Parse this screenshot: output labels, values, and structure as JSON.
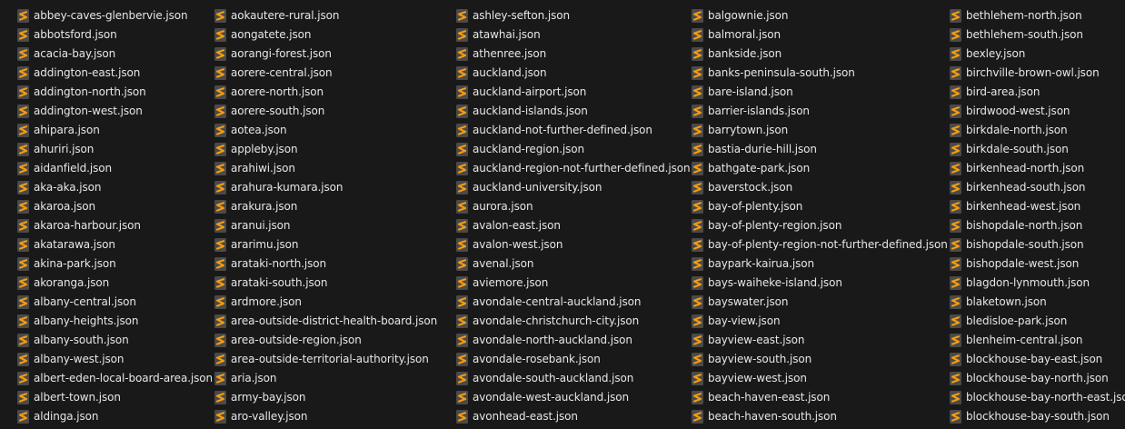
{
  "icon": {
    "name": "sublime-text-file-icon",
    "colors": {
      "background": "#4a4a4a",
      "accent": "#f39c12"
    }
  },
  "columns": [
    {
      "files": [
        "abbey-caves-glenbervie.json",
        "abbotsford.json",
        "acacia-bay.json",
        "addington-east.json",
        "addington-north.json",
        "addington-west.json",
        "ahipara.json",
        "ahuriri.json",
        "aidanfield.json",
        "aka-aka.json",
        "akaroa.json",
        "akaroa-harbour.json",
        "akatarawa.json",
        "akina-park.json",
        "akoranga.json",
        "albany-central.json",
        "albany-heights.json",
        "albany-south.json",
        "albany-west.json",
        "albert-eden-local-board-area.json",
        "albert-town.json",
        "aldinga.json"
      ]
    },
    {
      "files": [
        "aokautere-rural.json",
        "aongatete.json",
        "aorangi-forest.json",
        "aorere-central.json",
        "aorere-north.json",
        "aorere-south.json",
        "aotea.json",
        "appleby.json",
        "arahiwi.json",
        "arahura-kumara.json",
        "arakura.json",
        "aranui.json",
        "ararimu.json",
        "arataki-north.json",
        "arataki-south.json",
        "ardmore.json",
        "area-outside-district-health-board.json",
        "area-outside-region.json",
        "area-outside-territorial-authority.json",
        "aria.json",
        "army-bay.json",
        "aro-valley.json"
      ]
    },
    {
      "files": [
        "ashley-sefton.json",
        "atawhai.json",
        "athenree.json",
        "auckland.json",
        "auckland-airport.json",
        "auckland-islands.json",
        "auckland-not-further-defined.json",
        "auckland-region.json",
        "auckland-region-not-further-defined.json",
        "auckland-university.json",
        "aurora.json",
        "avalon-east.json",
        "avalon-west.json",
        "avenal.json",
        "aviemore.json",
        "avondale-central-auckland.json",
        "avondale-christchurch-city.json",
        "avondale-north-auckland.json",
        "avondale-rosebank.json",
        "avondale-south-auckland.json",
        "avondale-west-auckland.json",
        "avonhead-east.json"
      ]
    },
    {
      "files": [
        "balgownie.json",
        "balmoral.json",
        "bankside.json",
        "banks-peninsula-south.json",
        "bare-island.json",
        "barrier-islands.json",
        "barrytown.json",
        "bastia-durie-hill.json",
        "bathgate-park.json",
        "baverstock.json",
        "bay-of-plenty.json",
        "bay-of-plenty-region.json",
        "bay-of-plenty-region-not-further-defined.json",
        "baypark-kairua.json",
        "bays-waiheke-island.json",
        "bayswater.json",
        "bay-view.json",
        "bayview-east.json",
        "bayview-south.json",
        "bayview-west.json",
        "beach-haven-east.json",
        "beach-haven-south.json"
      ]
    },
    {
      "files": [
        "bethlehem-north.json",
        "bethlehem-south.json",
        "bexley.json",
        "birchville-brown-owl.json",
        "bird-area.json",
        "birdwood-west.json",
        "birkdale-north.json",
        "birkdale-south.json",
        "birkenhead-north.json",
        "birkenhead-south.json",
        "birkenhead-west.json",
        "bishopdale-north.json",
        "bishopdale-south.json",
        "bishopdale-west.json",
        "blagdon-lynmouth.json",
        "blaketown.json",
        "bledisloe-park.json",
        "blenheim-central.json",
        "blockhouse-bay-east.json",
        "blockhouse-bay-north.json",
        "blockhouse-bay-north-east.json",
        "blockhouse-bay-south.json"
      ]
    }
  ]
}
